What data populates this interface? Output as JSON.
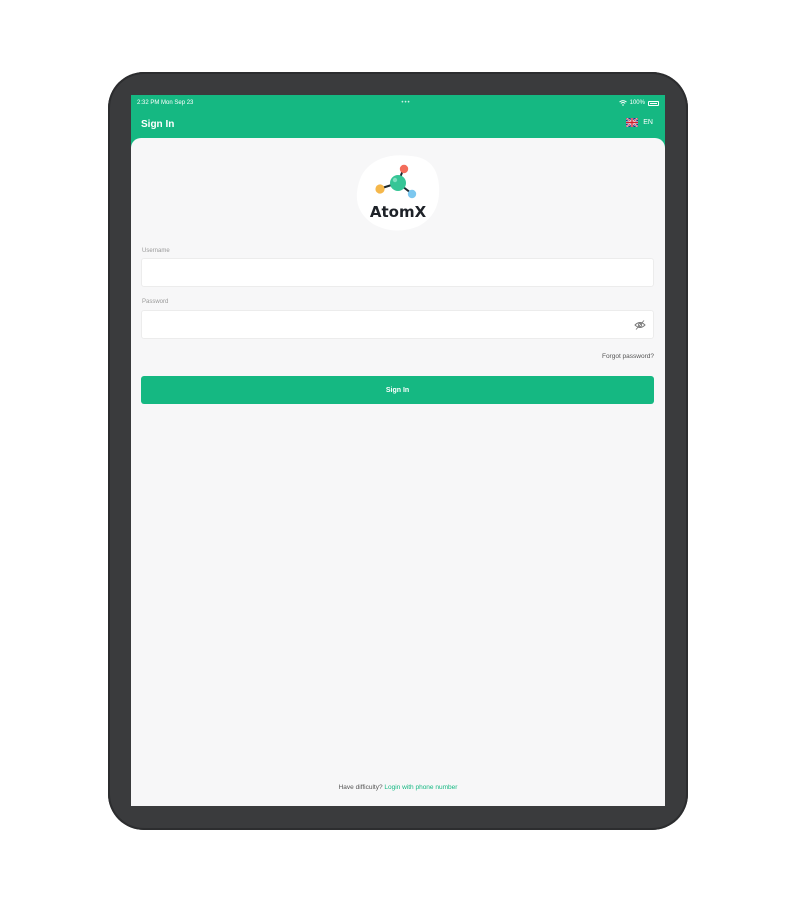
{
  "status_bar": {
    "time_date": "2:32 PM  Mon Sep 23",
    "center": "•••",
    "battery": "100%"
  },
  "nav": {
    "title": "Sign In",
    "language": "EN"
  },
  "logo": {
    "text": "AtomX"
  },
  "form": {
    "username_label": "Username",
    "username_value": "",
    "password_label": "Password",
    "password_value": "",
    "forgot_label": "Forgot password?",
    "submit_label": "Sign In"
  },
  "footer": {
    "prompt": "Have difficulty?",
    "link": "Login with phone number"
  },
  "colors": {
    "brand": "#15b882",
    "background": "#f7f7f8",
    "device_frame": "#3a3b3d"
  },
  "icons": [
    "wifi-icon",
    "battery-icon",
    "uk-flag-icon",
    "eye-off-icon",
    "atom-logo-icon"
  ]
}
